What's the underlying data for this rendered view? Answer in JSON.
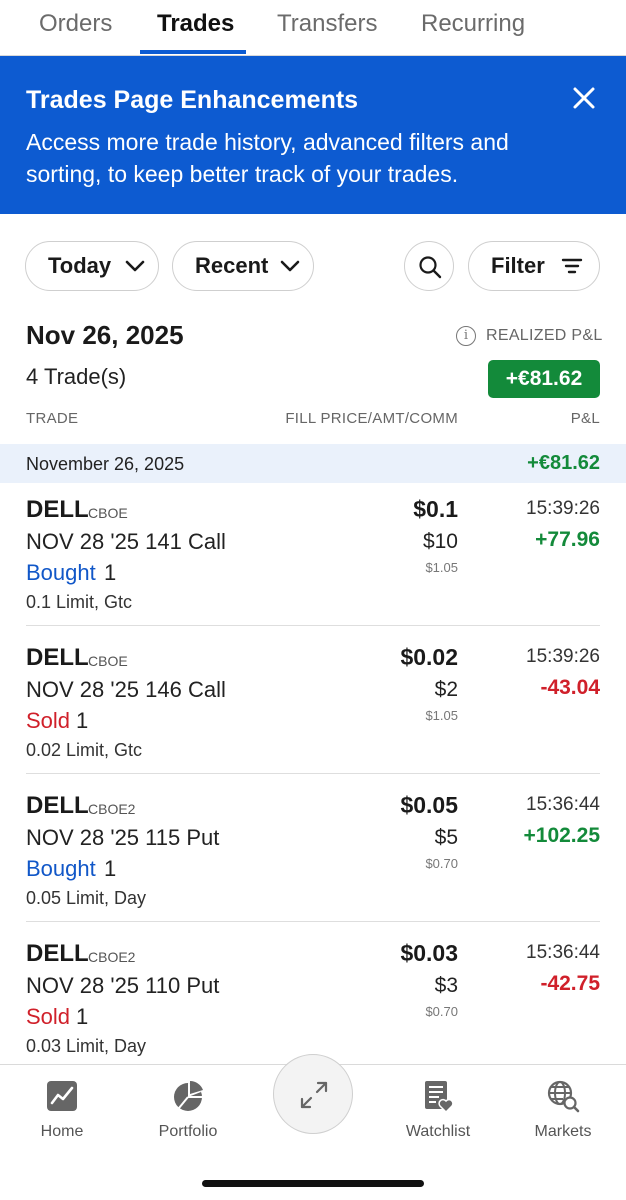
{
  "tabs": [
    {
      "label": "Orders"
    },
    {
      "label": "Trades"
    },
    {
      "label": "Transfers"
    },
    {
      "label": "Recurring"
    }
  ],
  "banner": {
    "title": "Trades Page Enhancements",
    "text": "Access more trade history, advanced filters and sorting, to keep better track of your trades.",
    "bg_color": "#0d5bd1"
  },
  "filters": {
    "period": "Today",
    "sort": "Recent",
    "filter_label": "Filter"
  },
  "summary": {
    "date": "Nov 26, 2025",
    "trades_count": "4 Trade(s)",
    "realized_label": "REALIZED P&L",
    "realized_value": "+€81.62"
  },
  "columns": {
    "trade": "TRADE",
    "fill": "FILL PRICE/AMT/COMM",
    "pl": "P&L"
  },
  "group": {
    "date": "November 26, 2025",
    "pl": "+€81.62"
  },
  "trades": [
    {
      "symbol": "DELL",
      "exchange": "CBOE",
      "contract": "NOV 28 '25 141 Call",
      "side": "Bought",
      "qty": "1",
      "order": "0.1 Limit, Gtc",
      "price": "$0.1",
      "amount": "$10",
      "commission": "$1.05",
      "time": "15:39:26",
      "pl": "+77.96"
    },
    {
      "symbol": "DELL",
      "exchange": "CBOE",
      "contract": "NOV 28 '25 146 Call",
      "side": "Sold",
      "qty": "1",
      "order": "0.02 Limit, Gtc",
      "price": "$0.02",
      "amount": "$2",
      "commission": "$1.05",
      "time": "15:39:26",
      "pl": "-43.04"
    },
    {
      "symbol": "DELL",
      "exchange": "CBOE2",
      "contract": "NOV 28 '25 115 Put",
      "side": "Bought",
      "qty": "1",
      "order": "0.05 Limit, Day",
      "price": "$0.05",
      "amount": "$5",
      "commission": "$0.70",
      "time": "15:36:44",
      "pl": "+102.25"
    },
    {
      "symbol": "DELL",
      "exchange": "CBOE2",
      "contract": "NOV 28 '25 110 Put",
      "side": "Sold",
      "qty": "1",
      "order": "0.03 Limit, Day",
      "price": "$0.03",
      "amount": "$3",
      "commission": "$0.70",
      "time": "15:36:44",
      "pl": "-42.75"
    }
  ],
  "nav": [
    {
      "label": "Home",
      "icon": "home-chart-icon"
    },
    {
      "label": "Portfolio",
      "icon": "pie-chart-icon"
    },
    {
      "label": "Watchlist",
      "icon": "watchlist-icon"
    },
    {
      "label": "Markets",
      "icon": "globe-search-icon"
    }
  ],
  "colors": {
    "accent": "#0b5bd3",
    "gain": "#138a3a",
    "loss": "#d0202a",
    "buy": "#1157c8"
  }
}
